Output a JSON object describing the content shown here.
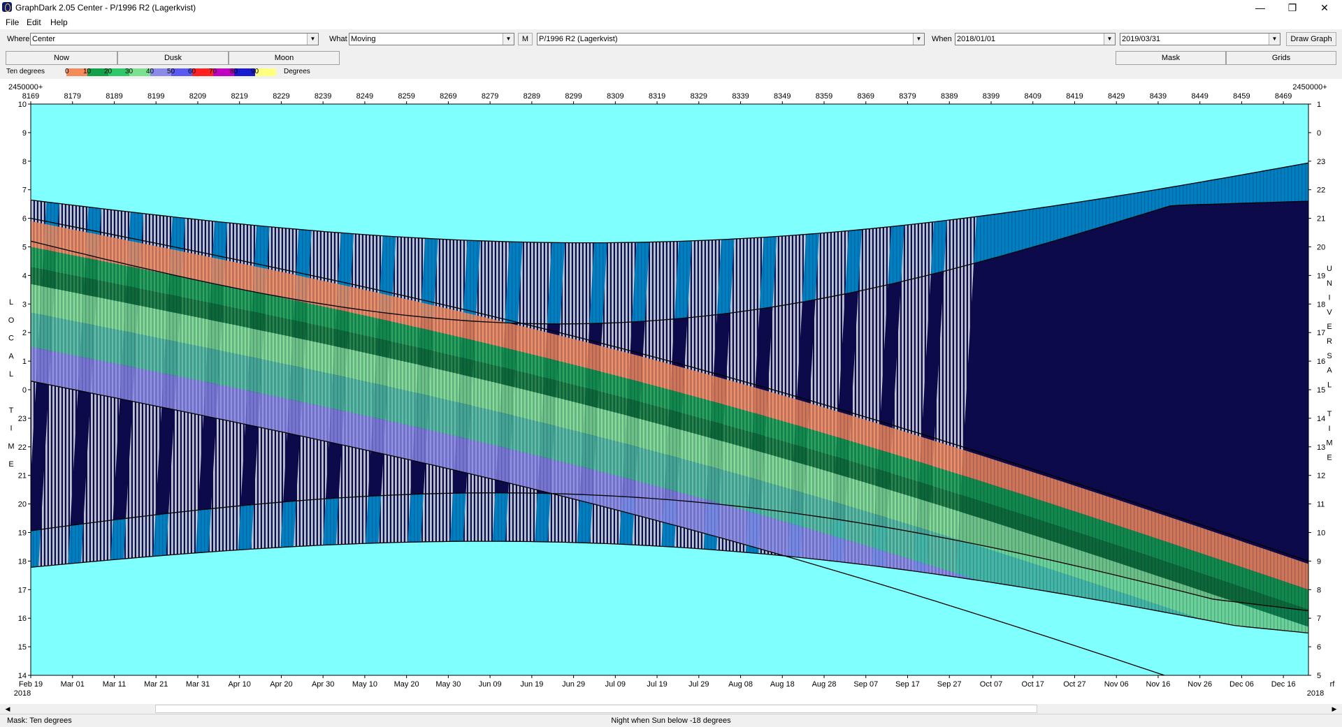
{
  "window": {
    "title": "GraphDark 2.05  Center  -  P/1996 R2 (Lagerkvist)"
  },
  "menu": [
    "File",
    "Edit",
    "Help"
  ],
  "toolbar": {
    "where_label": "Where",
    "where_value": "Center",
    "what_label": "What",
    "what_value": "Moving",
    "m_button": "M",
    "object_value": "P/1996 R2 (Lagerkvist)",
    "when_label": "When",
    "start_date": "2018/01/01",
    "end_date": "2019/03/31",
    "draw_button": "Draw Graph"
  },
  "tabs": {
    "now": "Now",
    "dusk": "Dusk",
    "moon": "Moon",
    "mask": "Mask",
    "grids": "Grids"
  },
  "legend": {
    "label": "Ten degrees",
    "numbers": [
      "0",
      "10",
      "20",
      "30",
      "40",
      "50",
      "60",
      "70",
      "80",
      "90"
    ],
    "unit": "Degrees",
    "colors": [
      "#f28a5a",
      "#13a04a",
      "#2fc76a",
      "#7be08f",
      "#8a8ae8",
      "#5a5af0",
      "#ff2020",
      "#c000c0",
      "#1a1ad0",
      "#ffff80"
    ]
  },
  "chart": {
    "jd_prefix": "2450000+",
    "top_ticks": [
      "8169",
      "8179",
      "8189",
      "8199",
      "8209",
      "8219",
      "8229",
      "8239",
      "8249",
      "8259",
      "8269",
      "8279",
      "8289",
      "8299",
      "8309",
      "8319",
      "8329",
      "8339",
      "8349",
      "8359",
      "8369",
      "8379",
      "8389",
      "8399",
      "8409",
      "8419",
      "8429",
      "8439",
      "8449",
      "8459",
      "8469"
    ],
    "bottom_ticks": [
      "Feb 19",
      "Mar 01",
      "Mar 11",
      "Mar 21",
      "Mar 31",
      "Apr 10",
      "Apr 20",
      "Apr 30",
      "May 10",
      "May 20",
      "May 30",
      "Jun 09",
      "Jun 19",
      "Jun 29",
      "Jul 09",
      "Jul 19",
      "Jul 29",
      "Aug 08",
      "Aug 18",
      "Aug 28",
      "Sep 07",
      "Sep 17",
      "Sep 27",
      "Oct 07",
      "Oct 17",
      "Oct 27",
      "Nov 06",
      "Nov 16",
      "Nov 26",
      "Dec 06",
      "Dec 16"
    ],
    "year_left": "2018",
    "year_right": "2018",
    "left_ticks": [
      "10",
      "9",
      "8",
      "7",
      "6",
      "5",
      "4",
      "3",
      "2",
      "1",
      "0",
      "23",
      "22",
      "21",
      "20",
      "19",
      "18",
      "17",
      "16",
      "15",
      "14"
    ],
    "right_ticks": [
      "1",
      "0",
      "23",
      "22",
      "21",
      "20",
      "19",
      "18",
      "17",
      "16",
      "15",
      "14",
      "13",
      "12",
      "11",
      "10",
      "9",
      "8",
      "7",
      "6",
      "5"
    ],
    "left_axis_title": "LOCAL TIME",
    "right_axis_title": "UNIVERSAL TIME",
    "corner_note": "rf",
    "colors": {
      "sky": "#80ffff",
      "night": "#0c0a4a",
      "twilight": "#0080c0",
      "moonlit": "#c8ccd6"
    }
  },
  "status": {
    "mask": "Mask:  Ten degrees",
    "night": "Night when Sun below -18 degrees"
  }
}
